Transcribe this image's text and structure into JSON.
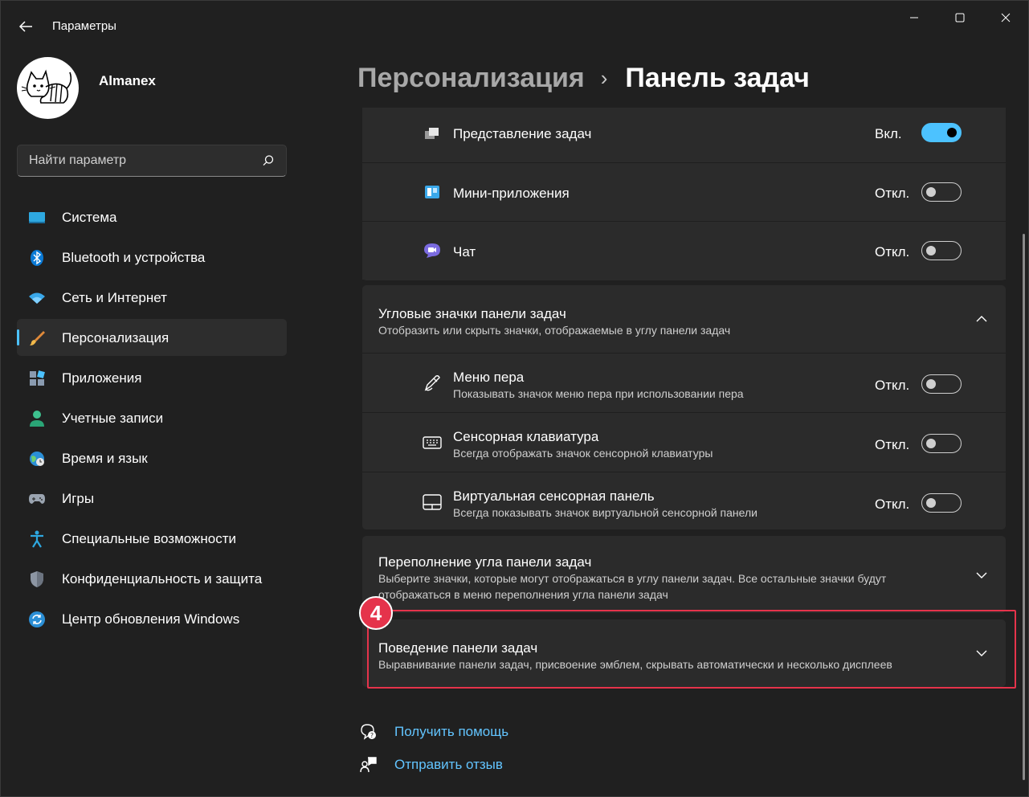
{
  "window": {
    "title": "Параметры"
  },
  "user": {
    "name": "Almanex"
  },
  "search": {
    "placeholder": "Найти параметр"
  },
  "sidebar": {
    "items": [
      {
        "label": "Система",
        "icon": "system-icon"
      },
      {
        "label": "Bluetooth и устройства",
        "icon": "bluetooth-icon"
      },
      {
        "label": "Сеть и Интернет",
        "icon": "wifi-icon"
      },
      {
        "label": "Персонализация",
        "icon": "brush-icon",
        "active": true
      },
      {
        "label": "Приложения",
        "icon": "apps-icon"
      },
      {
        "label": "Учетные записи",
        "icon": "account-icon"
      },
      {
        "label": "Время и язык",
        "icon": "globe-icon"
      },
      {
        "label": "Игры",
        "icon": "gamepad-icon"
      },
      {
        "label": "Специальные возможности",
        "icon": "accessibility-icon"
      },
      {
        "label": "Конфиденциальность и защита",
        "icon": "shield-icon"
      },
      {
        "label": "Центр обновления Windows",
        "icon": "update-icon"
      }
    ]
  },
  "header": {
    "parent": "Персонализация",
    "separator": "›",
    "current": "Панель задач"
  },
  "taskbar_items": [
    {
      "label": "Представление задач",
      "state": "Вкл.",
      "on": true,
      "icon": "task-view-icon"
    },
    {
      "label": "Мини-приложения",
      "state": "Откл.",
      "on": false,
      "icon": "widgets-icon"
    },
    {
      "label": "Чат",
      "state": "Откл.",
      "on": false,
      "icon": "chat-icon"
    }
  ],
  "corner_icons": {
    "title": "Угловые значки панели задач",
    "subtitle": "Отобразить или скрыть значки, отображаемые в углу панели задач",
    "expanded": true,
    "items": [
      {
        "label": "Меню пера",
        "sub": "Показывать значок меню пера при использовании пера",
        "state": "Откл.",
        "on": false,
        "icon": "pen-icon"
      },
      {
        "label": "Сенсорная клавиатура",
        "sub": "Всегда отображать значок сенсорной клавиатуры",
        "state": "Откл.",
        "on": false,
        "icon": "keyboard-icon"
      },
      {
        "label": "Виртуальная сенсорная панель",
        "sub": "Всегда показывать значок виртуальной сенсорной панели",
        "state": "Откл.",
        "on": false,
        "icon": "touchpad-icon"
      }
    ]
  },
  "overflow": {
    "title": "Переполнение угла панели задач",
    "subtitle_line1": "Выберите значки, которые могут отображаться в углу панели задач. Все остальные значки будут",
    "subtitle_line2": "отображаться в меню переполнения угла панели задач"
  },
  "behaviors": {
    "title": "Поведение панели задач",
    "subtitle": "Выравнивание панели задач, присвоение эмблем, скрывать автоматически и несколько дисплеев"
  },
  "annotation": {
    "badge": "4",
    "color": "#e5334b"
  },
  "links": {
    "help": "Получить помощь",
    "feedback": "Отправить отзыв"
  },
  "colors": {
    "accent": "#4cc2ff",
    "background": "#202020",
    "card": "#2b2b2b"
  }
}
